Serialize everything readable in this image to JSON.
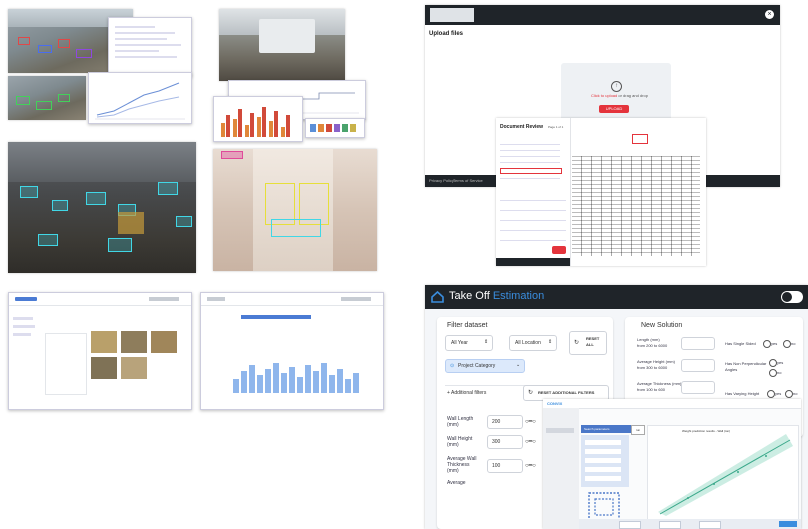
{
  "upload": {
    "title": "Upload files",
    "cta_link": "Click to upload",
    "cta_rest": " or drag and drop",
    "button": "UPLOAD",
    "footer_privacy": "Privacy Policy",
    "footer_terms": "Terms of Service"
  },
  "doc_review": {
    "title": "Document Review",
    "page": "Page 1 of 1"
  },
  "takeoff": {
    "title_main": "Take Off",
    "title_accent": "Estimation",
    "filter_title": "Filter dataset",
    "year_select": "All Year",
    "location_select": "All Location",
    "reset_all": "RESET\nALL",
    "project_category": "Project Category",
    "additional_filters": "Additional filters",
    "reset_additional": "RESET ADDITIONAL FILTERS",
    "wall_length": {
      "label": "Wall Length\n(mm)",
      "value": "200"
    },
    "wall_height": {
      "label": "Wall Height\n(mm)",
      "value": "300"
    },
    "avg_wall_thickness": {
      "label": "Average Wall\nThickness\n(mm)",
      "value": "100"
    },
    "average_label": "Average",
    "new_solution_title": "New Solution",
    "length_label": "Length (mm)\nfrom 200 to 6000",
    "avg_height_label": "Average Height (mm)\nfrom 300 to 6000",
    "avg_thickness_label": "Average Thickness (mm)\nfrom 100 to 600",
    "offsets_label": "Number of Offsets (nr)\nfrom 0 to 10",
    "single_sided": "Has Single Sided",
    "non_perp": "Has Non Perpendicular\nAngles",
    "varying_height": "Has Varying Height",
    "has_bows": "Has Bows",
    "yes": "yes",
    "no": "no",
    "colors": {
      "accent": "#3a8dde",
      "header": "#1f2429",
      "red": "#e4343c"
    }
  },
  "mini_app": {
    "brand": "CONVIX",
    "search_label": "Search parameters",
    "run_label": "run",
    "chart_title": "Weight prediction results - Wall (ton)"
  }
}
